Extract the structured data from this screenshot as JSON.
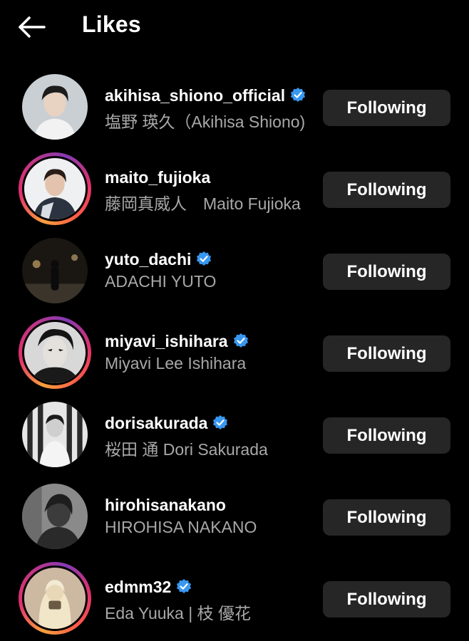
{
  "header": {
    "title": "Likes",
    "back_icon": "arrow-left-icon"
  },
  "colors": {
    "background": "#000000",
    "button_bg": "#262626",
    "secondary_text": "#a8a8a8",
    "verified_blue": "#3897f0"
  },
  "users": [
    {
      "username": "akihisa_shiono_official",
      "fullname": "塩野 瑛久（Akihisa Shiono)",
      "verified": true,
      "story_ring": false,
      "button": "Following"
    },
    {
      "username": "maito_fujioka",
      "fullname": "藤岡真威人　Maito Fujioka",
      "verified": false,
      "story_ring": true,
      "button": "Following"
    },
    {
      "username": "yuto_dachi",
      "fullname": "ADACHI YUTO",
      "verified": true,
      "story_ring": false,
      "button": "Following"
    },
    {
      "username": "miyavi_ishihara",
      "fullname": "Miyavi Lee Ishihara",
      "verified": true,
      "story_ring": true,
      "button": "Following"
    },
    {
      "username": "dorisakurada",
      "fullname": "桜田 通 Dori Sakurada",
      "verified": true,
      "story_ring": false,
      "button": "Following"
    },
    {
      "username": "hirohisanakano",
      "fullname": "HIROHISA NAKANO",
      "verified": false,
      "story_ring": false,
      "button": "Following"
    },
    {
      "username": "edmm32",
      "fullname": "Eda Yuuka | 枝 優花",
      "verified": true,
      "story_ring": true,
      "button": "Following"
    }
  ]
}
